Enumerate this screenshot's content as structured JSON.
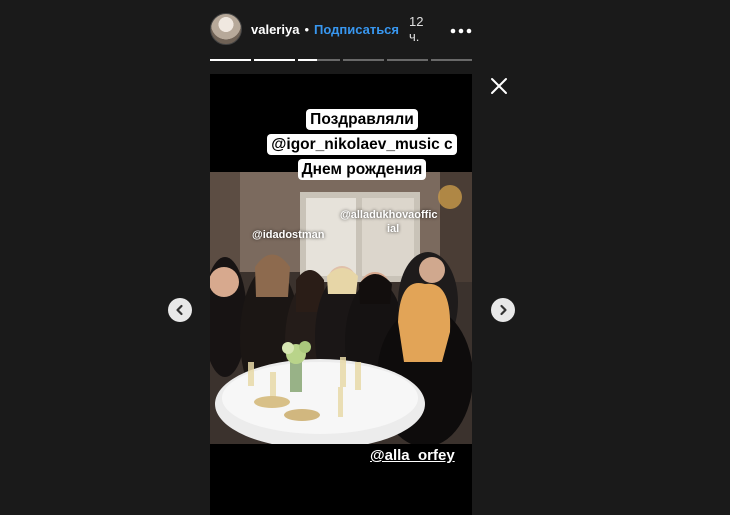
{
  "story": {
    "username": "valeriya",
    "separator": "•",
    "subscribe_label": "Подписаться",
    "time_ago": "12 ч.",
    "more_icon": "more-horizontal-icon",
    "close_icon": "close-icon",
    "progress": [
      1,
      1,
      0.45,
      0,
      0,
      0
    ],
    "caption_lines": [
      "Поздравляли",
      "@igor_nikolaev_music с",
      "Днем рождения"
    ],
    "mentions": {
      "idadostman": "@idadostman",
      "alladukhova_line1": "@alladukhovaoffic",
      "alladukhova_line2": "ial",
      "alla_orfey": "@alla_orfey"
    }
  },
  "navigation": {
    "prev_icon": "chevron-left-icon",
    "next_icon": "chevron-right-icon"
  },
  "colors": {
    "background": "#1a1a1a",
    "accent": "#3897f0",
    "sticker_bg": "#ffffff"
  }
}
